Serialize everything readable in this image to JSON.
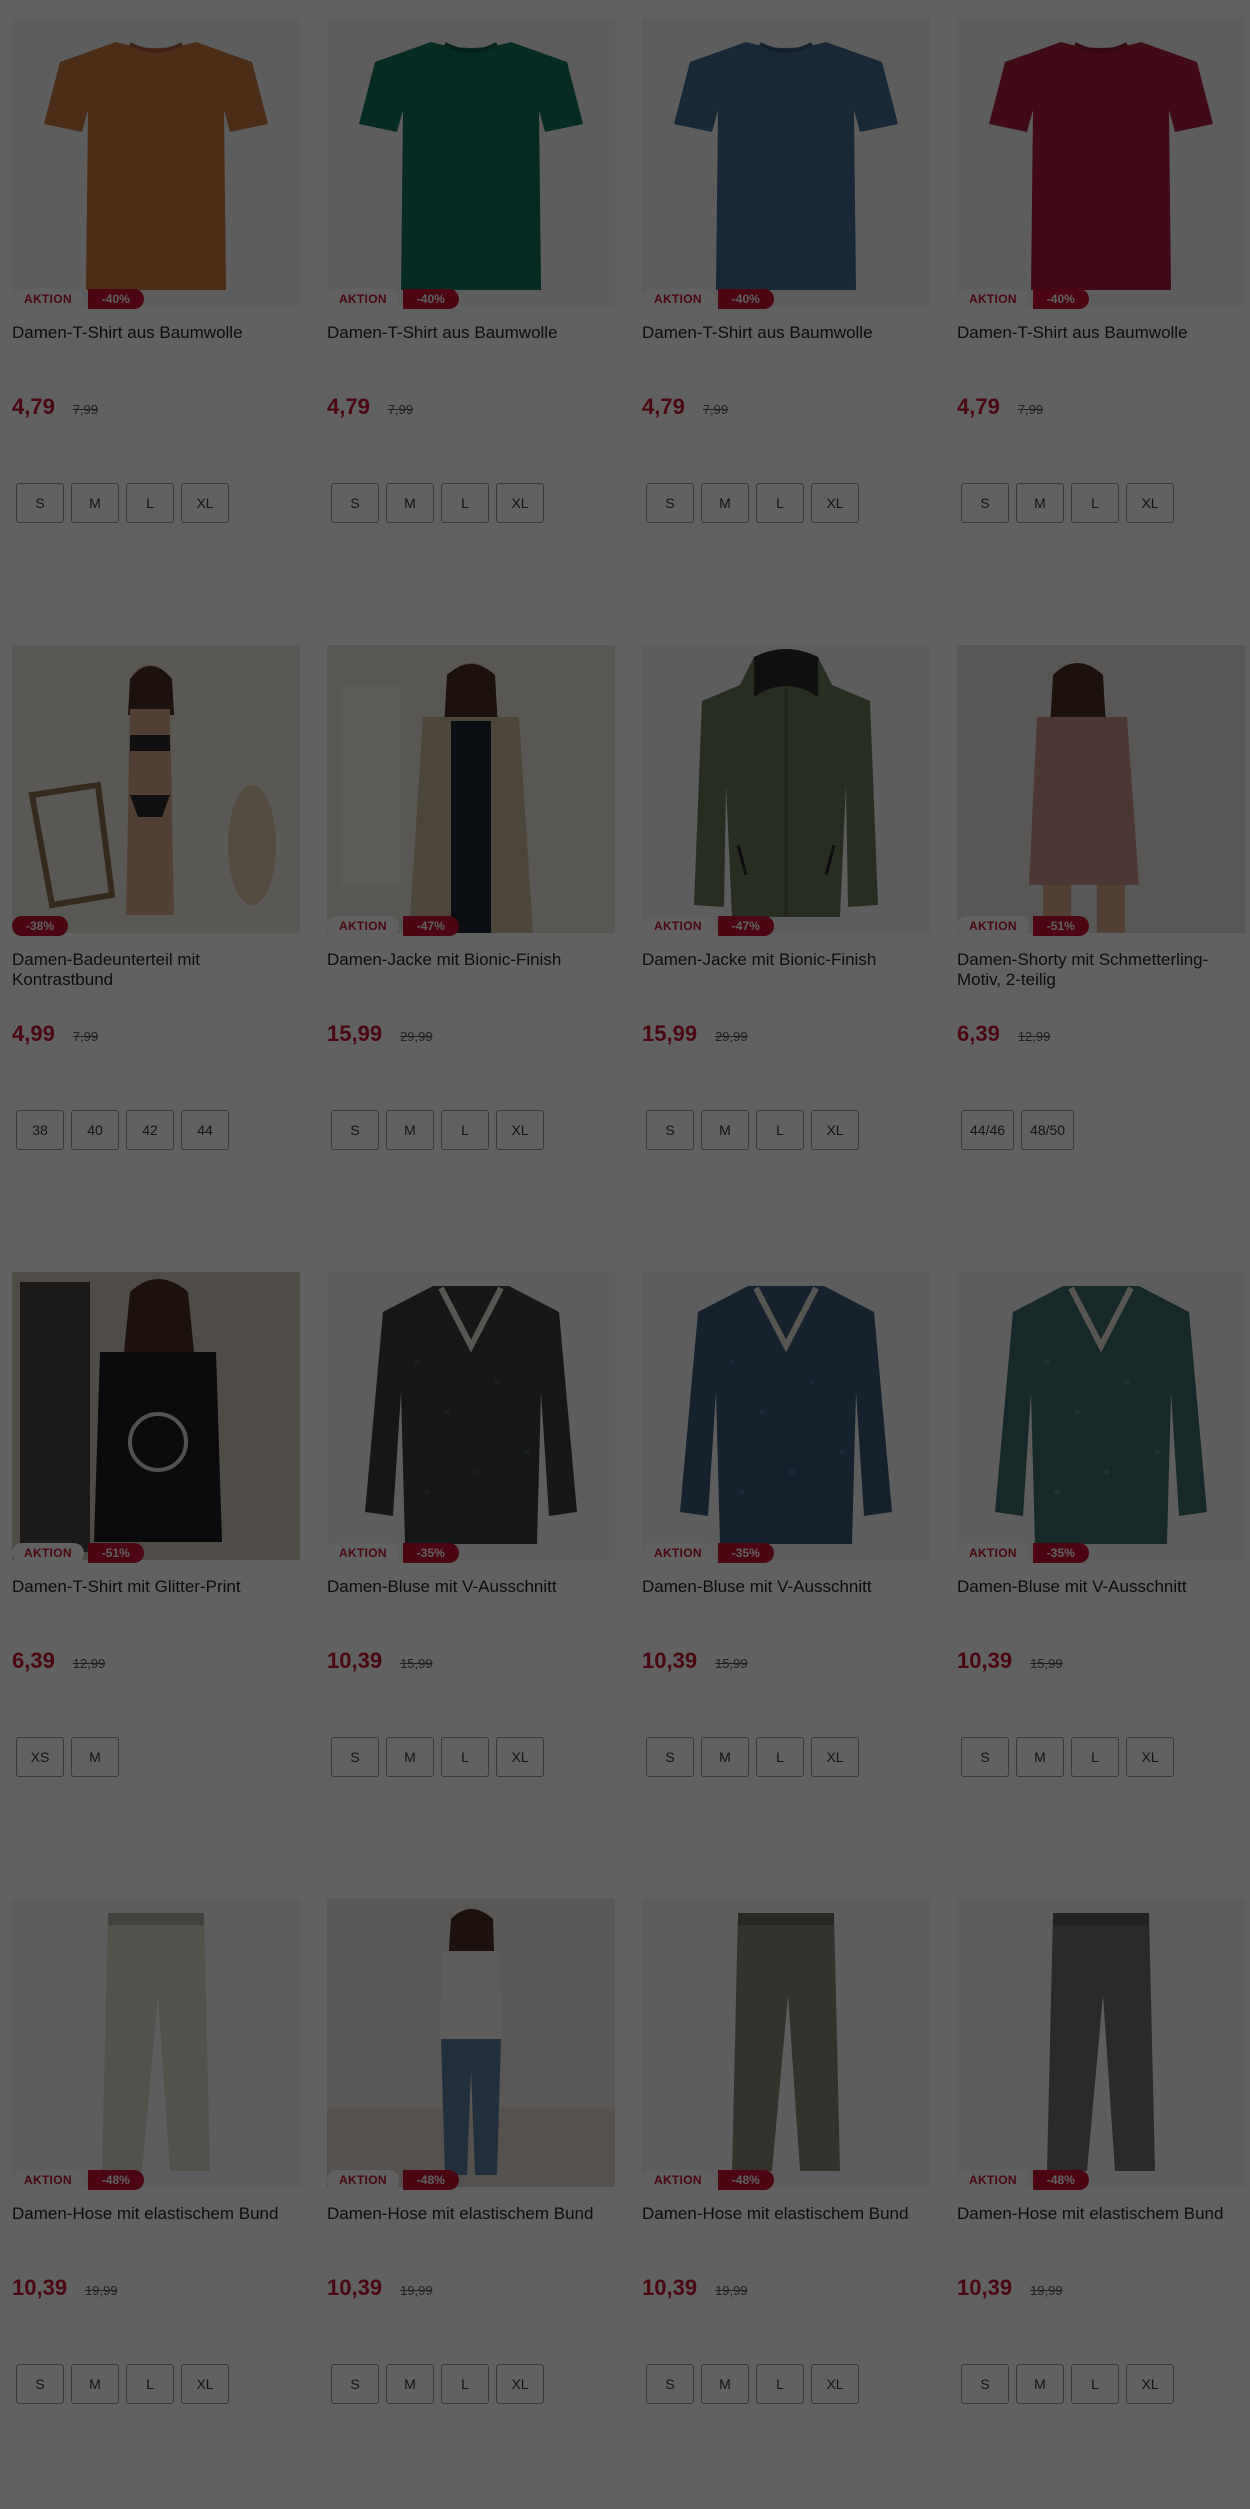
{
  "colors": {
    "price": "#c4122f",
    "badge_discount_bg": "#c4122f",
    "overlay": "rgba(0,0,0,0.62)"
  },
  "products": [
    {
      "badge": "AKTION",
      "discount": "-40%",
      "title": "Damen-T-Shirt aus Baumwolle",
      "price": "4,79",
      "old_price": "7,99",
      "sizes": [
        "S",
        "M",
        "L",
        "XL"
      ],
      "image": {
        "kind": "tshirt",
        "color": "#c8763f"
      }
    },
    {
      "badge": "AKTION",
      "discount": "-40%",
      "title": "Damen-T-Shirt aus Baumwolle",
      "price": "4,79",
      "old_price": "7,99",
      "sizes": [
        "S",
        "M",
        "L",
        "XL"
      ],
      "image": {
        "kind": "tshirt",
        "color": "#0f7159"
      }
    },
    {
      "badge": "AKTION",
      "discount": "-40%",
      "title": "Damen-T-Shirt aus Baumwolle",
      "price": "4,79",
      "old_price": "7,99",
      "sizes": [
        "S",
        "M",
        "L",
        "XL"
      ],
      "image": {
        "kind": "tshirt",
        "color": "#3f6b8f"
      }
    },
    {
      "badge": "AKTION",
      "discount": "-40%",
      "title": "Damen-T-Shirt aus Baumwolle",
      "price": "4,79",
      "old_price": "7,99",
      "sizes": [
        "S",
        "M",
        "L",
        "XL"
      ],
      "image": {
        "kind": "tshirt",
        "color": "#a81f3c"
      }
    },
    {
      "badge": "",
      "discount": "-38%",
      "title": "Damen-Badeunterteil mit Kontrastbund",
      "price": "4,99",
      "old_price": "7,99",
      "sizes": [
        "38",
        "40",
        "42",
        "44"
      ],
      "image": {
        "kind": "model-swim",
        "color": "#2a2a2a"
      }
    },
    {
      "badge": "AKTION",
      "discount": "-47%",
      "title": "Damen-Jacke mit Bionic-Finish",
      "price": "15,99",
      "old_price": "29,99",
      "sizes": [
        "S",
        "M",
        "L",
        "XL"
      ],
      "image": {
        "kind": "model-jacket",
        "color": "#c9b99a"
      }
    },
    {
      "badge": "AKTION",
      "discount": "-47%",
      "title": "Damen-Jacke mit Bionic-Finish",
      "price": "15,99",
      "old_price": "29,99",
      "sizes": [
        "S",
        "M",
        "L",
        "XL"
      ],
      "image": {
        "kind": "jacket",
        "color": "#6b7657"
      }
    },
    {
      "badge": "AKTION",
      "discount": "-51%",
      "title": "Damen-Shorty mit Schmetterling-Motiv, 2-teilig",
      "price": "6,39",
      "old_price": "12,99",
      "sizes": [
        "44/46",
        "48/50"
      ],
      "image": {
        "kind": "model-shorty",
        "color": "#c8928c"
      }
    },
    {
      "badge": "AKTION",
      "discount": "-51%",
      "title": "Damen-T-Shirt mit Glitter-Print",
      "price": "6,39",
      "old_price": "12,99",
      "sizes": [
        "XS",
        "M"
      ],
      "image": {
        "kind": "model-tee",
        "color": "#1e1e22"
      }
    },
    {
      "badge": "AKTION",
      "discount": "-35%",
      "title": "Damen-Bluse mit V-Ausschnitt",
      "price": "10,39",
      "old_price": "15,99",
      "sizes": [
        "S",
        "M",
        "L",
        "XL"
      ],
      "image": {
        "kind": "blouse",
        "color": "#3a4140"
      }
    },
    {
      "badge": "AKTION",
      "discount": "-35%",
      "title": "Damen-Bluse mit V-Ausschnitt",
      "price": "10,39",
      "old_price": "15,99",
      "sizes": [
        "S",
        "M",
        "L",
        "XL"
      ],
      "image": {
        "kind": "blouse",
        "color": "#3b577a"
      }
    },
    {
      "badge": "AKTION",
      "discount": "-35%",
      "title": "Damen-Bluse mit V-Ausschnitt",
      "price": "10,39",
      "old_price": "15,99",
      "sizes": [
        "S",
        "M",
        "L",
        "XL"
      ],
      "image": {
        "kind": "blouse",
        "color": "#3d6b6c"
      }
    },
    {
      "badge": "AKTION",
      "discount": "-48%",
      "title": "Damen-Hose mit elastischem Bund",
      "price": "10,39",
      "old_price": "19,99",
      "sizes": [
        "S",
        "M",
        "L",
        "XL"
      ],
      "image": {
        "kind": "pants",
        "color": "#d9d4c8"
      }
    },
    {
      "badge": "AKTION",
      "discount": "-48%",
      "title": "Damen-Hose mit elastischem Bund",
      "price": "10,39",
      "old_price": "19,99",
      "sizes": [
        "S",
        "M",
        "L",
        "XL"
      ],
      "image": {
        "kind": "model-pants",
        "color": "#5a7fa3"
      }
    },
    {
      "badge": "AKTION",
      "discount": "-48%",
      "title": "Damen-Hose mit elastischem Bund",
      "price": "10,39",
      "old_price": "19,99",
      "sizes": [
        "S",
        "M",
        "L",
        "XL"
      ],
      "image": {
        "kind": "pants",
        "color": "#8a8478"
      }
    },
    {
      "badge": "AKTION",
      "discount": "-48%",
      "title": "Damen-Hose mit elastischem Bund",
      "price": "10,39",
      "old_price": "19,99",
      "sizes": [
        "S",
        "M",
        "L",
        "XL"
      ],
      "image": {
        "kind": "pants",
        "color": "#6f7069"
      }
    }
  ]
}
